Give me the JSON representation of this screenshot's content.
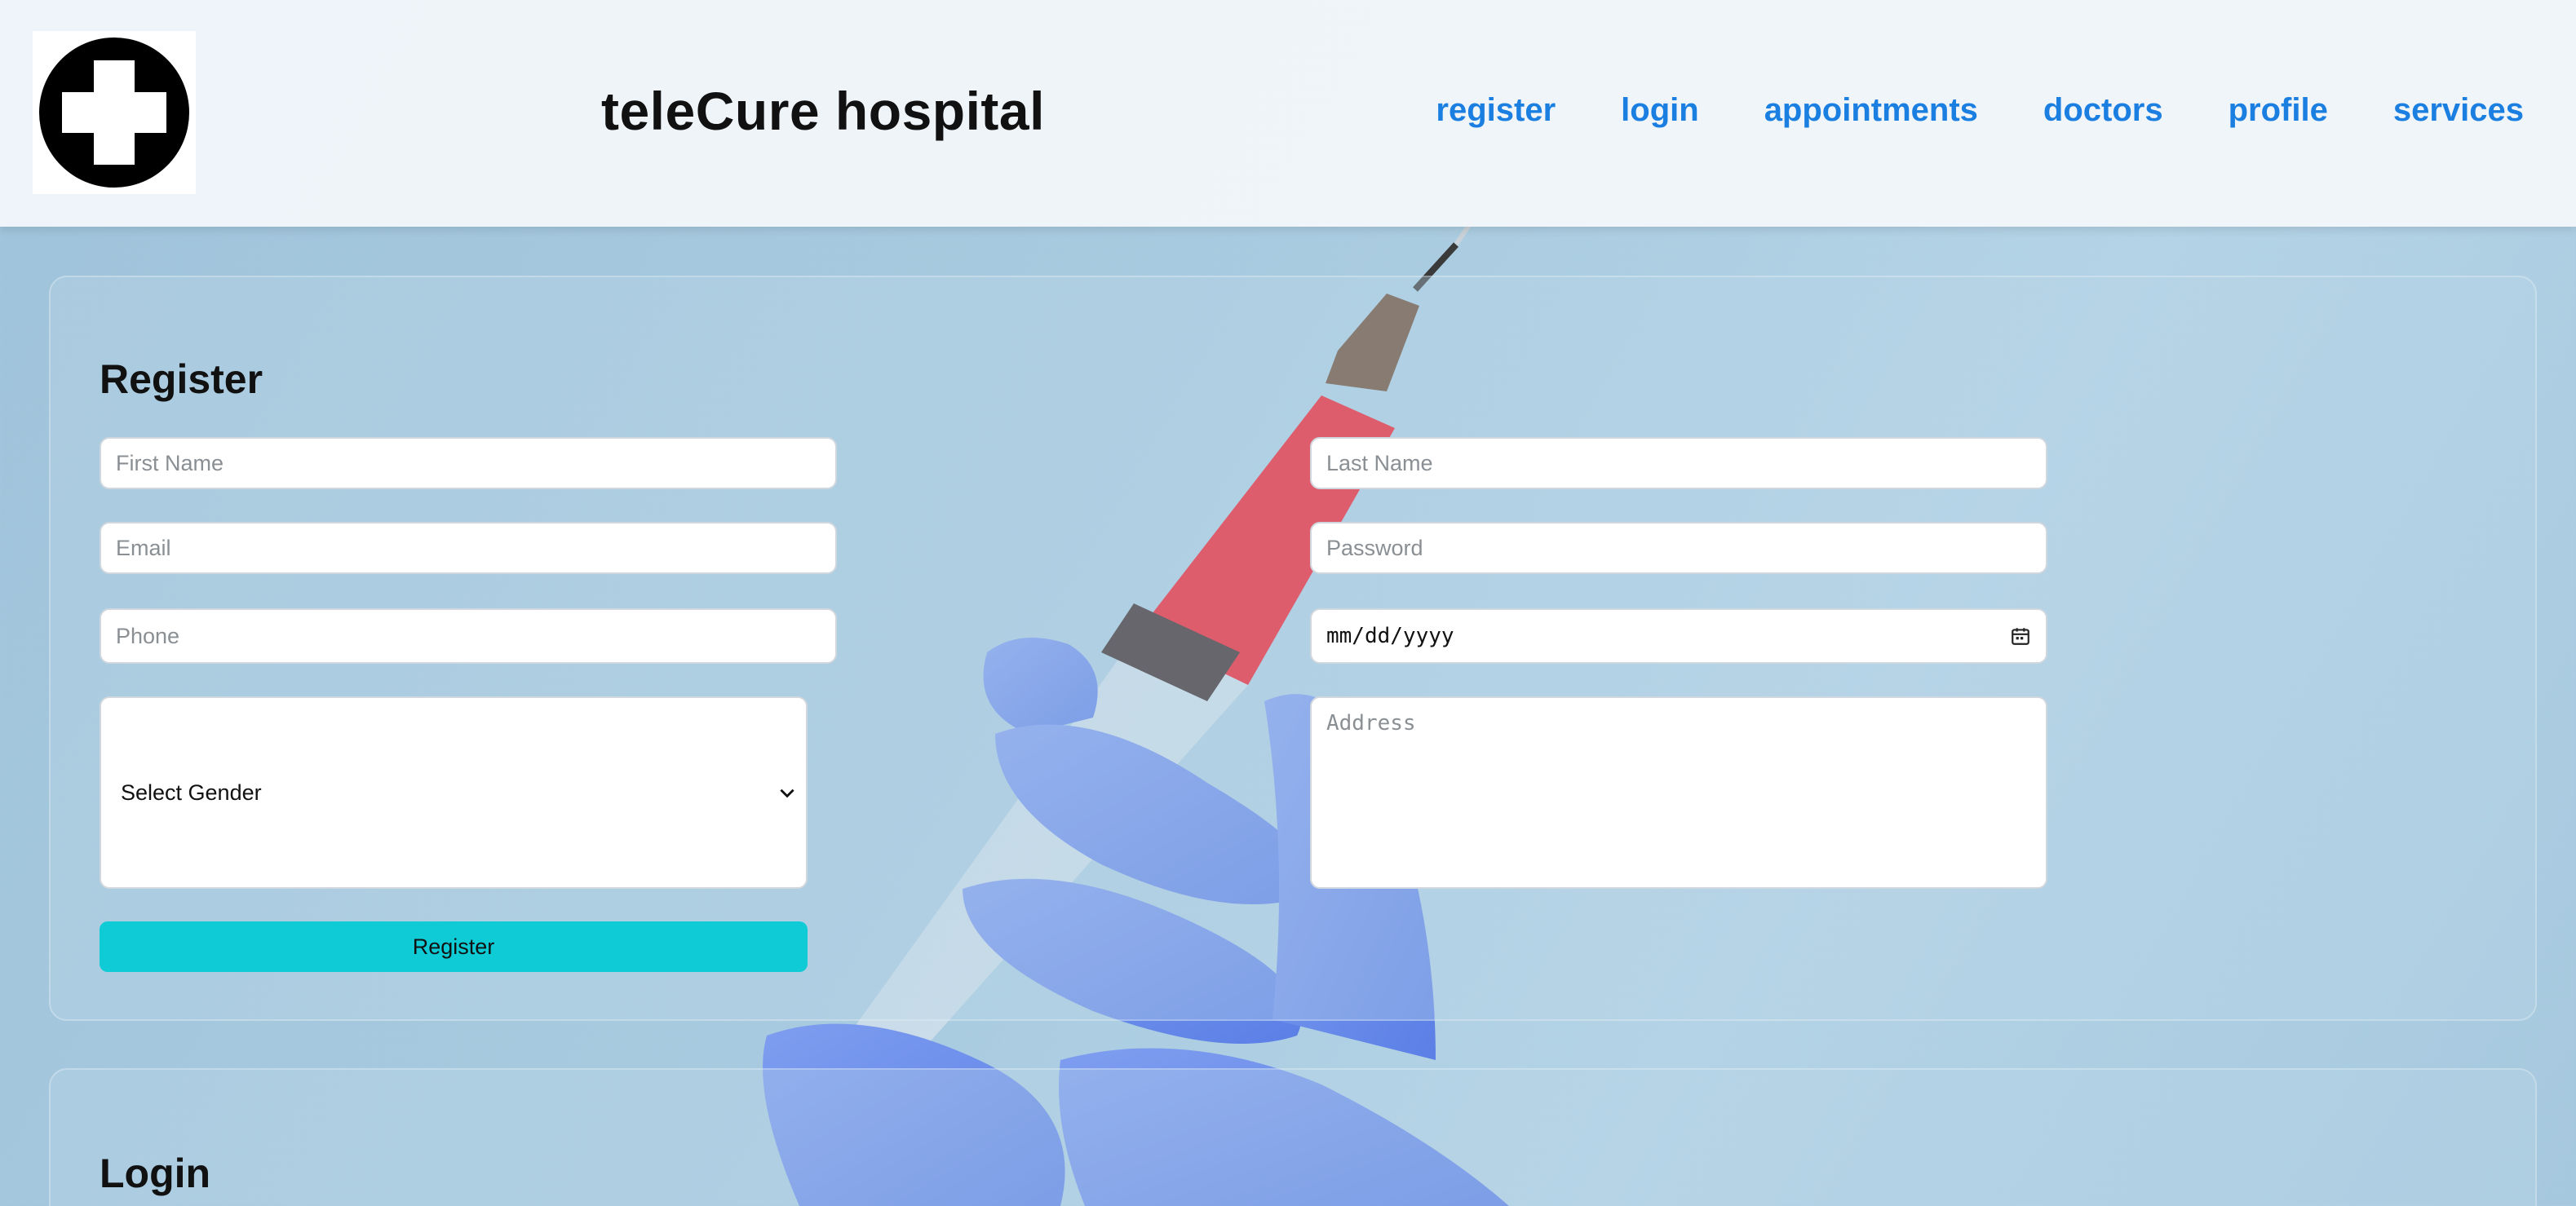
{
  "header": {
    "title": "teleCure hospital",
    "nav": [
      "register",
      "login",
      "appointments",
      "doctors",
      "profile",
      "services"
    ]
  },
  "register": {
    "heading": "Register",
    "first_name_placeholder": "First Name",
    "last_name_placeholder": "Last Name",
    "email_placeholder": "Email",
    "password_placeholder": "Password",
    "phone_placeholder": "Phone",
    "dob_value": "mm/dd/yyyy",
    "gender_selected": "Select Gender",
    "address_placeholder": "Address",
    "button_label": "Register"
  },
  "login": {
    "heading": "Login"
  },
  "colors": {
    "nav_link": "#1a7fe0",
    "register_button": "#0ecbd6"
  },
  "icons": [
    "medical-cross-icon",
    "calendar-icon",
    "chevron-down-icon"
  ]
}
